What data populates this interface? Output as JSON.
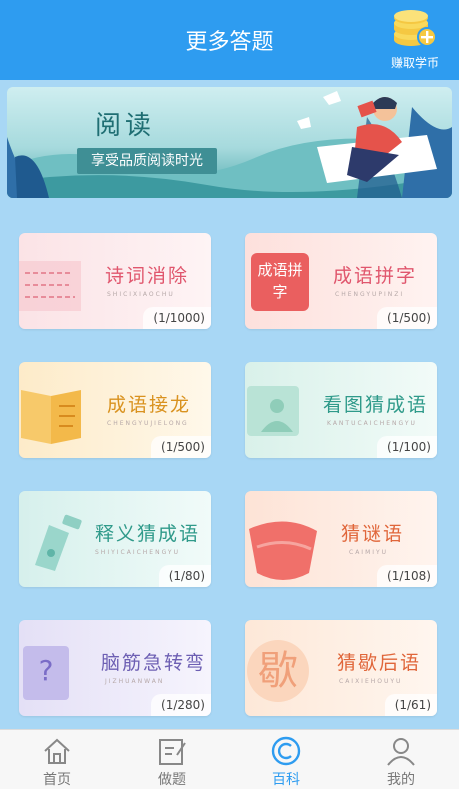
{
  "header": {
    "title": "更多答题",
    "earn_label": "赚取学币"
  },
  "banner": {
    "title": "阅读",
    "subtitle": "享受品质阅读时光"
  },
  "cards": [
    {
      "name": "诗词消除",
      "pinyin": "SHICIXIAOCHU",
      "count": "(1/1000)",
      "color": "#e0566d"
    },
    {
      "name": "成语拼字",
      "pinyin": "CHENGYUPINZI",
      "count": "(1/500)",
      "color": "#e0566d",
      "art_text": "成语拼字"
    },
    {
      "name": "成语接龙",
      "pinyin": "CHENGYUJIELONG",
      "count": "(1/500)",
      "color": "#d9921f"
    },
    {
      "name": "看图猜成语",
      "pinyin": "KANTUCAICHENGYU",
      "count": "(1/100)",
      "color": "#2f9a8a"
    },
    {
      "name": "释义猜成语",
      "pinyin": "SHIYICAICHENGYU",
      "count": "(1/80)",
      "color": "#2f9a8a"
    },
    {
      "name": "猜谜语",
      "pinyin": "CAIMIYU",
      "count": "(1/108)",
      "color": "#e0663a"
    },
    {
      "name": "脑筋急转弯",
      "pinyin": "JIZHUANWAN",
      "count": "(1/280)",
      "color": "#6d5fb3"
    },
    {
      "name": "猜歇后语",
      "pinyin": "CAIXIEHOUYU",
      "count": "(1/61)",
      "color": "#e0663a",
      "art_text": "歇"
    }
  ],
  "tabs": [
    {
      "label": "首页",
      "icon": "home-icon",
      "active": false
    },
    {
      "label": "做题",
      "icon": "edit-icon",
      "active": false
    },
    {
      "label": "百科",
      "icon": "encyclopedia-icon",
      "active": true
    },
    {
      "label": "我的",
      "icon": "user-icon",
      "active": false
    }
  ],
  "colors": {
    "header": "#2e9cf0",
    "background": "#a8d7f5",
    "active_tab": "#2e9cf0"
  }
}
